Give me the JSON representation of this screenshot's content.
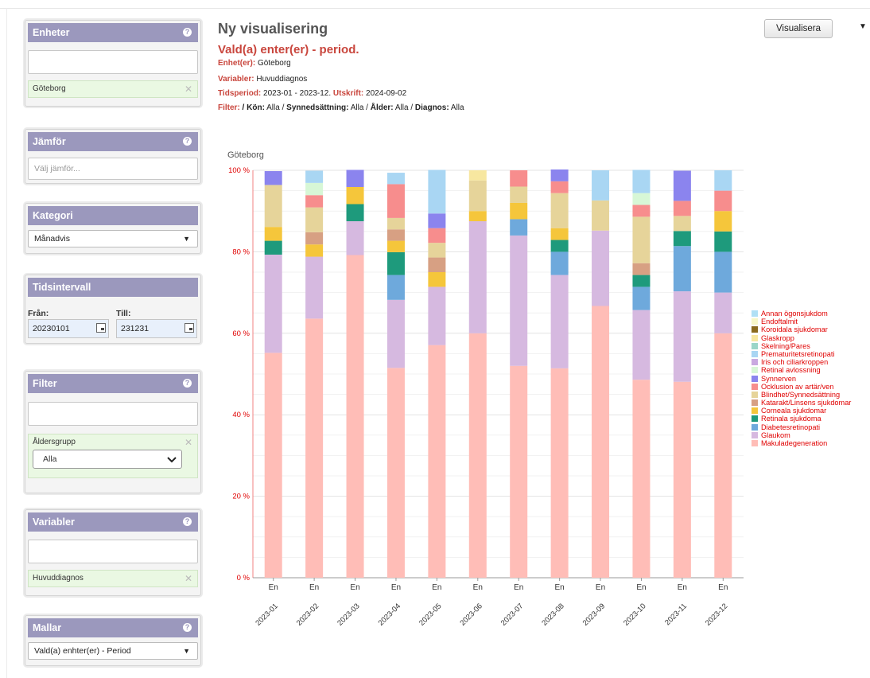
{
  "sidebar": {
    "enheter": {
      "title": "Enheter",
      "chip": "Göteborg"
    },
    "jamfor": {
      "title": "Jämför",
      "placeholder": "Välj jämför..."
    },
    "kategori": {
      "title": "Kategori",
      "selected": "Månadvis"
    },
    "tidsintervall": {
      "title": "Tidsintervall",
      "from_label": "Från:",
      "from_value": "20230101",
      "to_label": "Till:",
      "to_value": "231231"
    },
    "filter": {
      "title": "Filter",
      "chip_title": "Åldersgrupp",
      "chip_value": "Alla"
    },
    "variabler": {
      "title": "Variabler",
      "chip": "Huvuddiagnos"
    },
    "mallar": {
      "title": "Mallar",
      "selected": "Vald(a) enhter(er) - Period"
    }
  },
  "header": {
    "title": "Ny visualisering",
    "subtitle": "Vald(a) enter(er) - period.",
    "enhet_label": "Enhet(er):",
    "enhet_value": "Göteborg",
    "variabler_label": "Variabler:",
    "variabler_value": "Huvuddiagnos",
    "tidsperiod_label": "Tidsperiod:",
    "tidsperiod_value": "2023-01 - 2023-12.",
    "utskrift_label": "Utskrift:",
    "utskrift_value": "2024-09-02",
    "filter_label": "Filter:",
    "filter_text_1": " / ",
    "kon_label": "Kön:",
    "kon_value": " Alla / ",
    "syn_label": "Synnedsättning:",
    "syn_value": " Alla / ",
    "alder_label": "Ålder:",
    "alder_value": " Alla / ",
    "diagnos_label": "Diagnos:",
    "diagnos_value": " Alla",
    "visualize_button": "Visualisera",
    "menu_glyph": "▼"
  },
  "colors": {
    "panel_header": "#9b98bd",
    "accent_red": "#c9463d",
    "chip_bg": "#eaf8e3"
  },
  "chart_data": {
    "type": "bar",
    "stacked": true,
    "title": "Göteborg",
    "xlabel": "",
    "ylabel": "",
    "ylim": [
      0,
      100
    ],
    "y_ticks": [
      "0 %",
      "20 %",
      "40 %",
      "60 %",
      "80 %",
      "100 %"
    ],
    "categories": [
      "2023-01",
      "2023-02",
      "2023-03",
      "2023-04",
      "2023-05",
      "2023-06",
      "2023-07",
      "2023-08",
      "2023-09",
      "2023-10",
      "2023-11",
      "2023-12"
    ],
    "bar_label": "En",
    "legend_position": "right",
    "series": [
      {
        "name": "Makuladegeneration",
        "color": "#ffbdb7",
        "values": [
          55.2,
          63.6,
          79.2,
          51.5,
          57.1,
          60.0,
          52.0,
          51.4,
          66.7,
          48.6,
          48.1,
          60.0
        ]
      },
      {
        "name": "Glaukom",
        "color": "#d6b9e0",
        "values": [
          24.1,
          15.2,
          8.3,
          16.7,
          14.3,
          27.5,
          32.0,
          22.9,
          18.5,
          17.1,
          22.2,
          10.0
        ]
      },
      {
        "name": "Diabetesretinopati",
        "color": "#6ea9dc",
        "values": [
          0,
          0,
          0,
          6.1,
          0,
          0,
          4.0,
          5.7,
          0,
          5.7,
          11.1,
          10.0
        ]
      },
      {
        "name": "Retinala sjukdoma",
        "color": "#1e9a7c",
        "values": [
          3.4,
          0,
          4.2,
          5.6,
          0,
          0,
          0,
          2.9,
          0,
          2.9,
          3.7,
          5.0
        ]
      },
      {
        "name": "Corneala sjukdomar",
        "color": "#f5c63b",
        "values": [
          3.4,
          3.0,
          4.2,
          2.8,
          3.6,
          2.5,
          4.0,
          2.9,
          0,
          0,
          0,
          5.0
        ]
      },
      {
        "name": "Katarakt/Linsens sjukdomar",
        "color": "#d7a083",
        "values": [
          0,
          3.0,
          0,
          2.8,
          3.6,
          0,
          0,
          0,
          0,
          2.9,
          0,
          0
        ]
      },
      {
        "name": "Blindhet/Synnedsättning",
        "color": "#e6d49a",
        "values": [
          10.3,
          6.1,
          0,
          2.8,
          3.6,
          7.5,
          4.0,
          8.6,
          7.4,
          11.4,
          3.7,
          0
        ]
      },
      {
        "name": "Ocklusion av artär/ven",
        "color": "#f78d8d",
        "values": [
          0,
          3.0,
          0,
          8.3,
          3.6,
          0,
          4.0,
          2.9,
          0,
          2.9,
          3.7,
          5.0
        ]
      },
      {
        "name": "Synnerven",
        "color": "#8b84ee",
        "values": [
          3.4,
          0,
          4.2,
          0,
          3.6,
          0,
          0,
          2.9,
          0,
          0,
          7.4,
          0
        ]
      },
      {
        "name": "Retinal avlossning",
        "color": "#d7f7d6",
        "values": [
          0,
          3.0,
          0,
          0,
          0,
          0,
          0,
          0,
          0,
          2.9,
          0,
          0
        ]
      },
      {
        "name": "Iris och ciliarkroppen",
        "color": "#c9a9e0",
        "values": [
          0,
          0,
          0,
          0,
          0,
          0,
          0,
          0,
          0,
          0,
          0,
          0
        ]
      },
      {
        "name": "Prematuritetsretinopati",
        "color": "#a9d6f3",
        "values": [
          0,
          3.0,
          0,
          2.8,
          10.7,
          0,
          0,
          0,
          7.4,
          5.7,
          0,
          5.0
        ]
      },
      {
        "name": "Skelning/Pares",
        "color": "#9bd6c8",
        "values": [
          0,
          0,
          0,
          0,
          0,
          0,
          0,
          0,
          0,
          0,
          0,
          0
        ]
      },
      {
        "name": "Glaskropp",
        "color": "#f7e7a0",
        "values": [
          0,
          0,
          0,
          0,
          0,
          2.5,
          0,
          0,
          0,
          0,
          0,
          0
        ]
      },
      {
        "name": "Koroidala sjukdomar",
        "color": "#8a6a1e",
        "values": [
          0,
          0,
          0,
          0,
          0,
          0,
          0,
          0,
          0,
          0,
          0,
          0
        ]
      },
      {
        "name": "Endoftalmit",
        "color": "#f7f7c8",
        "values": [
          0,
          0,
          0,
          0,
          0,
          0,
          0,
          0,
          0,
          0,
          0,
          0
        ]
      },
      {
        "name": "Annan ögonsjukdom",
        "color": "#b0e0f5",
        "values": [
          0,
          0,
          0,
          0,
          0,
          0,
          0,
          0,
          0,
          0,
          0,
          0
        ]
      }
    ]
  }
}
